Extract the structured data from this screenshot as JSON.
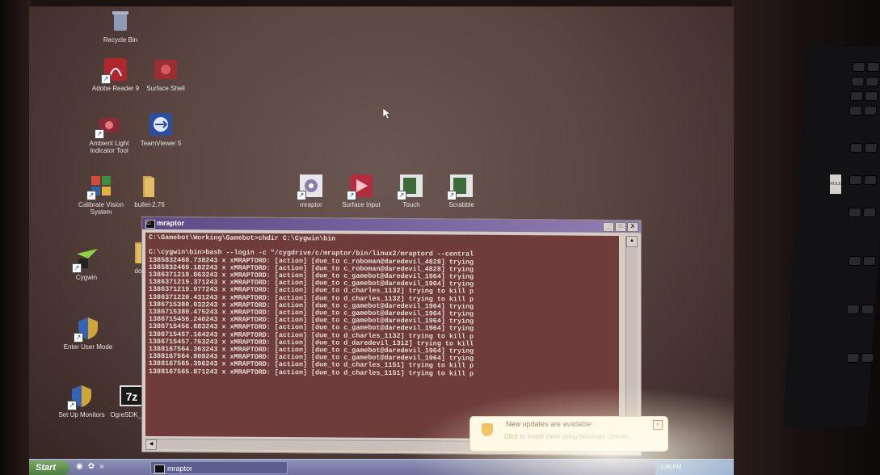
{
  "desktop": {
    "icons": [
      {
        "id": "recycle-bin",
        "label": "Recycle Bin"
      },
      {
        "id": "adobe-reader",
        "label": "Adobe Reader 9"
      },
      {
        "id": "surface-shell",
        "label": "Surface Shell"
      },
      {
        "id": "ambient-light",
        "label": "Ambient Light Indicator Tool"
      },
      {
        "id": "teamviewer",
        "label": "TeamViewer 5"
      },
      {
        "id": "calibrate-vision",
        "label": "Calibrate Vision System"
      },
      {
        "id": "bullet",
        "label": "bullet-2.76"
      },
      {
        "id": "cygwin",
        "label": "Cygwin"
      },
      {
        "id": "docs",
        "label": "docs"
      },
      {
        "id": "enter-user-mode",
        "label": "Enter User Mode"
      },
      {
        "id": "set-up-monitors",
        "label": "Set Up Monitors"
      },
      {
        "id": "ogresdk",
        "label": "OgreSDK_vc..."
      },
      {
        "id": "mraptor",
        "label": "mraptor"
      },
      {
        "id": "surface-input",
        "label": "Surface Input"
      },
      {
        "id": "touch",
        "label": "Touch"
      },
      {
        "id": "scrabble",
        "label": "Scrabble"
      }
    ]
  },
  "window": {
    "title": "mraptor",
    "buttons": {
      "minimize": "_",
      "maximize": "□",
      "close": "X"
    },
    "terminal_text": "C:\\Gamebot\\Working\\Gamebot>chdir C:\\Cygwin\\bin\n\nC:\\cygwin\\bin>bash --login -c \"/cygdrive/c/mraptor/bin/linux2/mraptord --central\n1385832468.738243 x xMRAPTORD: [action] [due_to c_roboman@daredevil_4828] trying\n1385832469.182243 x xMRAPTORD: [action] [due_to c_roboman@daredevil_4828] trying\n1386371218.863243 x xMRAPTORD: [action] [due_to c_gamebot@daredevil_1964] trying\n1386371219.371243 x xMRAPTORD: [action] [due_to c_gamebot@daredevil_1964] trying\n1386371219.977243 x xMRAPTORD: [action] [due_to d_charles_1132] trying to kill p\n1386371220.431243 x xMRAPTORD: [action] [due_to d_charles_1132] trying to kill p\n1386715380.032243 x xMRAPTORD: [action] [due_to c_gamebot@daredevil_1964] trying\n1386715380.475243 x xMRAPTORD: [action] [due_to c_gamebot@daredevil_1964] trying\n1386715456.240243 x xMRAPTORD: [action] [due_to c_gamebot@daredevil_1964] trying\n1386715456.683243 x xMRAPTORD: [action] [due_to c_gamebot@daredevil_1964] trying\n1386715457.164243 x xMRAPTORD: [action] [due_to d_charles_1132] trying to kill p\n1386715457.763243 x xMRAPTORD: [action] [due_to d_daredevil_1312] trying to kill\n1388167564.363243 x xMRAPTORD: [action] [due_to c_gamebot@daredevil_1964] trying\n1388167564.909243 x xMRAPTORD: [action] [due_to c_gamebot@daredevil_1964] trying\n1388167565.396243 x xMRAPTORD: [action] [due_to d_charles_1151] trying to kill p\n1388167565.871243 x xMRAPTORD: [action] [due_to d_charles_1151] trying to kill p"
  },
  "notification": {
    "title": "New updates are available",
    "text": "Click to install them using Windows Update.",
    "close": "x"
  },
  "taskbar": {
    "start_label": "Start",
    "task_label": "mraptor",
    "clock": "1:36 PM",
    "quick_launch": "»"
  },
  "keyboard_sticker": "ROLE",
  "colors": {
    "terminal_bg": "#6e3d3b",
    "title_bar": "#5b4a86",
    "taskbar": "#6b6f9a"
  }
}
